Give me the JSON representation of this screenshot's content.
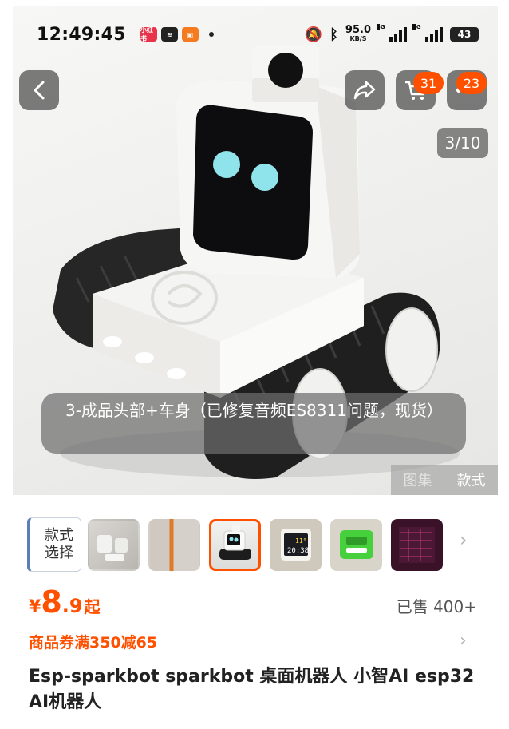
{
  "status_bar": {
    "time": "12:49:45",
    "app_icons": [
      "小红书",
      "≋",
      "▣"
    ],
    "net_speed_value": "95.0",
    "net_speed_unit": "KB/S",
    "signal_1_tag": "5G",
    "signal_2_tag": "5G",
    "battery": "43"
  },
  "gallery": {
    "cart_count": "31",
    "more_count": "23",
    "page_indicator": "3/10",
    "caption": "3-成品头部+车身（已修复音频ES8311问题，现货）",
    "view_tabs": [
      "图集",
      "款式"
    ]
  },
  "style_selector": {
    "label_line1": "款式",
    "label_line2": "选择",
    "selected_index": 2,
    "thumb_count": 6
  },
  "price": {
    "currency": "¥",
    "integer": "8",
    "decimal": ".9",
    "suffix": "起",
    "sold": "已售 400+"
  },
  "coupon": {
    "text": "商品券满350减65"
  },
  "product": {
    "title": "Esp-sparkbot sparkbot 桌面机器人 小智AI esp32 AI机器人"
  },
  "colors": {
    "accent": "#ff5000",
    "overlay": "#6e6e6e"
  },
  "icons": [
    "back-icon",
    "share-icon",
    "cart-icon",
    "more-icon",
    "chevron-right-icon"
  ]
}
